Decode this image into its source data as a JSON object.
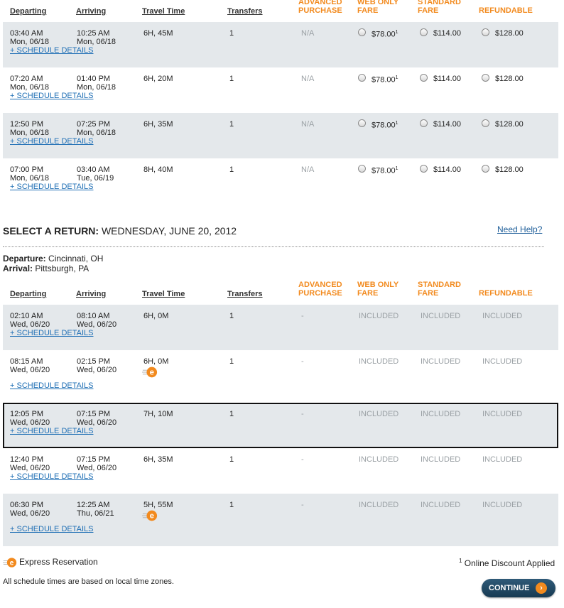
{
  "headers": {
    "departing": "Departing",
    "arriving": "Arriving",
    "travel_time": "Travel Time",
    "transfers": "Transfers",
    "advanced_1": "ADVANCED",
    "advanced_2": "PURCHASE",
    "webonly_1": "WEB ONLY",
    "webonly_2": "FARE",
    "standard_1": "STANDARD",
    "standard_2": "FARE",
    "refundable": "REFUNDABLE"
  },
  "outbound_rows": [
    {
      "dep_time": "03:40 AM",
      "dep_date": "Mon, 06/18",
      "arr_time": "10:25 AM",
      "arr_date": "Mon, 06/18",
      "travel": "6H, 45M",
      "transfers": "1",
      "advanced": "N/A",
      "web": "$78.00",
      "web_sup": "1",
      "standard": "$114.00",
      "refundable": "$128.00",
      "sched": "+ SCHEDULE DETAILS"
    },
    {
      "dep_time": "07:20 AM",
      "dep_date": "Mon, 06/18",
      "arr_time": "01:40 PM",
      "arr_date": "Mon, 06/18",
      "travel": "6H, 20M",
      "transfers": "1",
      "advanced": "N/A",
      "web": "$78.00",
      "web_sup": "1",
      "standard": "$114.00",
      "refundable": "$128.00",
      "sched": "+ SCHEDULE DETAILS"
    },
    {
      "dep_time": "12:50 PM",
      "dep_date": "Mon, 06/18",
      "arr_time": "07:25 PM",
      "arr_date": "Mon, 06/18",
      "travel": "6H, 35M",
      "transfers": "1",
      "advanced": "N/A",
      "web": "$78.00",
      "web_sup": "1",
      "standard": "$114.00",
      "refundable": "$128.00",
      "sched": "+ SCHEDULE DETAILS"
    },
    {
      "dep_time": "07:00 PM",
      "dep_date": "Mon, 06/18",
      "arr_time": "03:40 AM",
      "arr_date": "Tue, 06/19",
      "travel": "8H, 40M",
      "transfers": "1",
      "advanced": "N/A",
      "web": "$78.00",
      "web_sup": "1",
      "standard": "$114.00",
      "refundable": "$128.00",
      "sched": "+ SCHEDULE DETAILS"
    }
  ],
  "return_section": {
    "title_bold": "SELECT A RETURN:",
    "title_rest": " WEDNESDAY, JUNE 20, 2012",
    "need_help": "Need Help?",
    "departure_label": "Departure:",
    "departure_value": " Cincinnati, OH",
    "arrival_label": "Arrival:",
    "arrival_value": " Pittsburgh, PA"
  },
  "return_rows": [
    {
      "dep_time": "02:10 AM",
      "dep_date": "Wed, 06/20",
      "arr_time": "08:10 AM",
      "arr_date": "Wed, 06/20",
      "travel": "6H, 0M",
      "transfers": "1",
      "advanced": "-",
      "web": "INCLUDED",
      "standard": "INCLUDED",
      "refundable": "INCLUDED",
      "sched": "+ SCHEDULE DETAILS",
      "express": false
    },
    {
      "dep_time": "08:15 AM",
      "dep_date": "Wed, 06/20",
      "arr_time": "02:15 PM",
      "arr_date": "Wed, 06/20",
      "travel": "6H, 0M",
      "transfers": "1",
      "advanced": "-",
      "web": "INCLUDED",
      "standard": "INCLUDED",
      "refundable": "INCLUDED",
      "sched": "+ SCHEDULE DETAILS",
      "express": true
    },
    {
      "dep_time": "12:05 PM",
      "dep_date": "Wed, 06/20",
      "arr_time": "07:15 PM",
      "arr_date": "Wed, 06/20",
      "travel": "7H, 10M",
      "transfers": "1",
      "advanced": "-",
      "web": "INCLUDED",
      "standard": "INCLUDED",
      "refundable": "INCLUDED",
      "sched": "+ SCHEDULE DETAILS",
      "express": false
    },
    {
      "dep_time": "12:40 PM",
      "dep_date": "Wed, 06/20",
      "arr_time": "07:15 PM",
      "arr_date": "Wed, 06/20",
      "travel": "6H, 35M",
      "transfers": "1",
      "advanced": "-",
      "web": "INCLUDED",
      "standard": "INCLUDED",
      "refundable": "INCLUDED",
      "sched": "+ SCHEDULE DETAILS",
      "express": false
    },
    {
      "dep_time": "06:30 PM",
      "dep_date": "Wed, 06/20",
      "arr_time": "12:25 AM",
      "arr_date": "Thu, 06/21",
      "travel": "5H, 55M",
      "transfers": "1",
      "advanced": "-",
      "web": "INCLUDED",
      "standard": "INCLUDED",
      "refundable": "INCLUDED",
      "sched": "+ SCHEDULE DETAILS",
      "express": true
    }
  ],
  "footer": {
    "express_legend": "Express Reservation",
    "discount_sup": "1",
    "discount_note": " Online Discount Applied",
    "timezone_note": "All schedule times are based on local time zones.",
    "continue_label": "CONTINUE",
    "continue_arrow": "›"
  },
  "colors": {
    "accent_orange": "#f28a1e",
    "row_shade": "#e4e8eb",
    "link_blue": "#1f6fb5",
    "button_navy": "#173a52"
  }
}
